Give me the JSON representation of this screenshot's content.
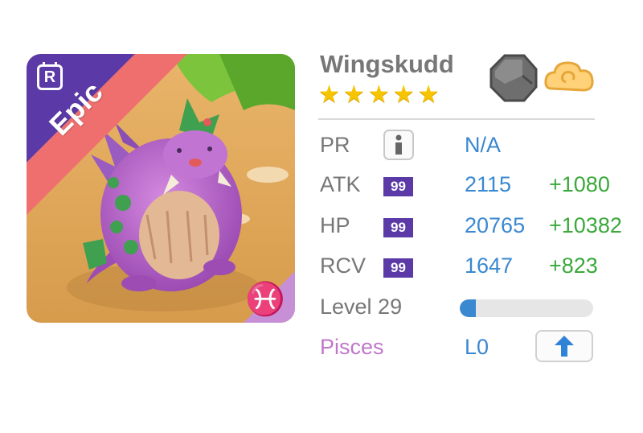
{
  "monster": {
    "name": "Wingskudd",
    "stars": 5,
    "rarity": "Epic",
    "rank_letter": "R",
    "zodiac_glyph": "♓",
    "elements": [
      "stone-icon",
      "cloud-swirl-icon"
    ]
  },
  "stats": {
    "pr": {
      "label": "PR",
      "value": "N/A"
    },
    "atk": {
      "label": "ATK",
      "badge": "99",
      "value": "2115",
      "bonus": "+1080"
    },
    "hp": {
      "label": "HP",
      "badge": "99",
      "value": "20765",
      "bonus": "+10382"
    },
    "rcv": {
      "label": "RCV",
      "badge": "99",
      "value": "1647",
      "bonus": "+823"
    }
  },
  "level": {
    "label": "Level 29",
    "progress": 0.12
  },
  "sign": {
    "label": "Pisces",
    "value": "L0"
  },
  "colors": {
    "rarity_band": "#ef6f6f",
    "rank_corner": "#5b3aa8",
    "zodiac_corner": "#c78fd6",
    "stat_value": "#3a88d0",
    "bonus_value": "#3aa83a",
    "pisces_text": "#c078c8"
  }
}
